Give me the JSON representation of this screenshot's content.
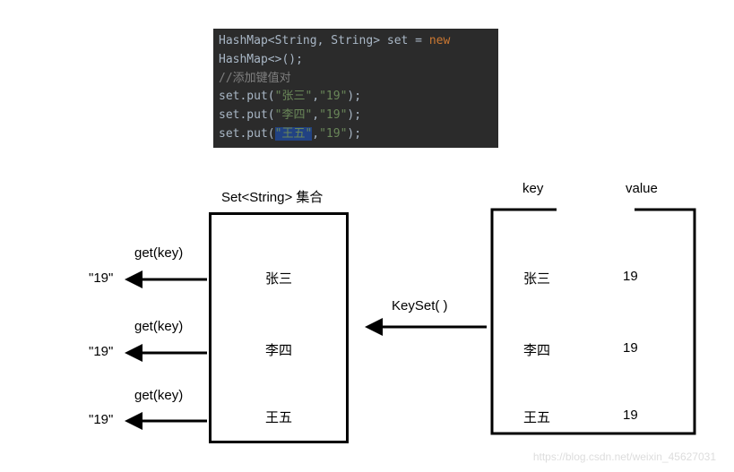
{
  "code": {
    "line1_p1": "HashMap",
    "line1_p2": "<",
    "line1_p3": "String",
    "line1_p4": ", ",
    "line1_p5": "String",
    "line1_p6": "> set = ",
    "line1_p7": "new ",
    "line1_p8": "HashMap<>();",
    "line2": "//添加键值对",
    "line3_p1": "set.put(",
    "line3_p2": "\"张三\"",
    "line3_p3": ",",
    "line3_p4": "\"19\"",
    "line3_p5": ");",
    "line4_p1": "set.put(",
    "line4_p2": "\"李四\"",
    "line4_p3": ",",
    "line4_p4": "\"19\"",
    "line4_p5": ");",
    "line5_p1": "set.put(",
    "line5_p2": "\"王五\"",
    "line5_p3": ",",
    "line5_p4": "\"19\"",
    "line5_p5": ");"
  },
  "labels": {
    "set_title": "Set<String> 集合",
    "key": "key",
    "value": "value",
    "keyset": "KeySet( )",
    "get1": "get(key)",
    "get2": "get(key)",
    "get3": "get(key)"
  },
  "set_items": {
    "i1": "张三",
    "i2": "李四",
    "i3": "王五"
  },
  "map_items": {
    "k1": "张三",
    "v1": "19",
    "k2": "李四",
    "v2": "19",
    "k3": "王五",
    "v3": "19"
  },
  "results": {
    "r1": "\"19\"",
    "r2": "\"19\"",
    "r3": "\"19\""
  },
  "watermark": "https://blog.csdn.net/weixin_45627031"
}
